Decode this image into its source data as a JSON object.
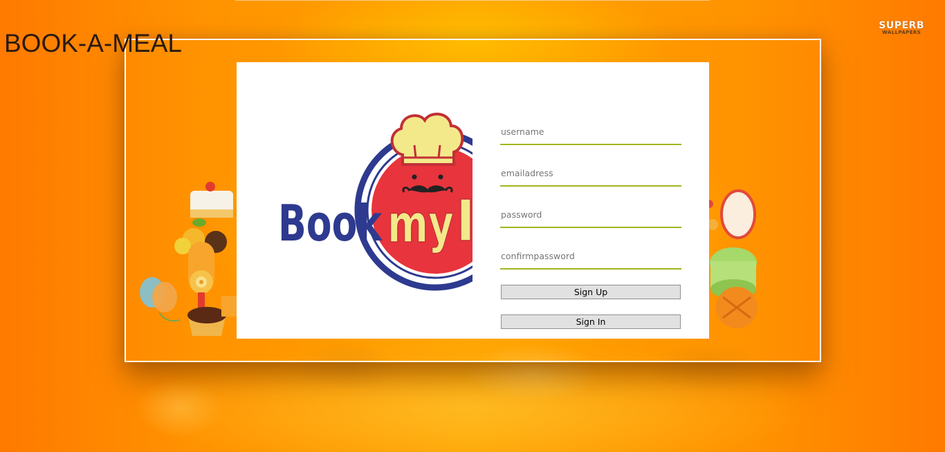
{
  "app": {
    "brand_title": "BOOK-A-MEAL"
  },
  "watermark": {
    "line1": "SUPERB",
    "line2": "WALLPAPERS"
  },
  "logo": {
    "text_book": "Book",
    "text_my": "my",
    "alt_name": "Bookmymeal logo"
  },
  "form": {
    "username": {
      "placeholder": "username",
      "value": ""
    },
    "email": {
      "placeholder": "emailadress",
      "value": ""
    },
    "password": {
      "placeholder": "password",
      "value": ""
    },
    "confirm_password": {
      "placeholder": "confirmpassword",
      "value": ""
    },
    "signup_label": "Sign Up",
    "signin_label": "Sign In"
  },
  "colors": {
    "accent_underline": "#a3b51e",
    "background_orange": "#ff9200",
    "logo_blue": "#2e3a8f",
    "logo_red": "#e8343c",
    "logo_yellow": "#f3e98a"
  }
}
